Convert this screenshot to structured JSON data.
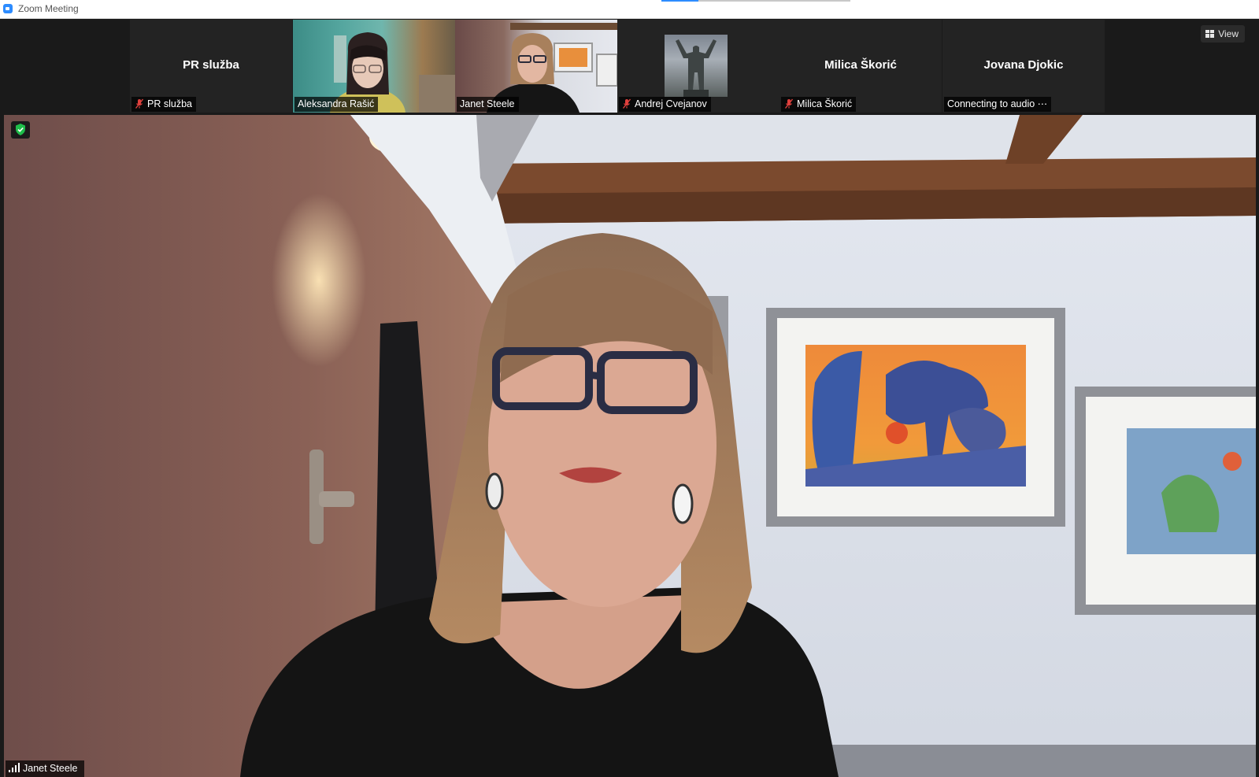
{
  "window": {
    "title": "Zoom Meeting"
  },
  "view_button": {
    "label": "View"
  },
  "participants": [
    {
      "display_name": "PR služba",
      "label": "PR služba",
      "muted": true,
      "video": false
    },
    {
      "display_name": "",
      "label": "Aleksandra Rašić",
      "muted": false,
      "video": true
    },
    {
      "display_name": "",
      "label": "Janet Steele",
      "muted": false,
      "video": true,
      "active_speaker": true
    },
    {
      "display_name": "",
      "label": "Andrej Cvejanov",
      "muted": true,
      "video": false,
      "profile_picture": true
    },
    {
      "display_name": "Milica Škorić",
      "label": "Milica Škorić",
      "muted": true,
      "video": false
    },
    {
      "display_name": "Jovana Djokic",
      "label": "Connecting to audio ⋯",
      "muted": false,
      "video": false
    }
  ],
  "main_speaker": {
    "name": "Janet Steele"
  },
  "colors": {
    "accent_blue": "#2d8cff",
    "active_speaker_border": "#7ed321",
    "muted_red": "#e0403d",
    "encryption_green": "#1fbd4a"
  }
}
